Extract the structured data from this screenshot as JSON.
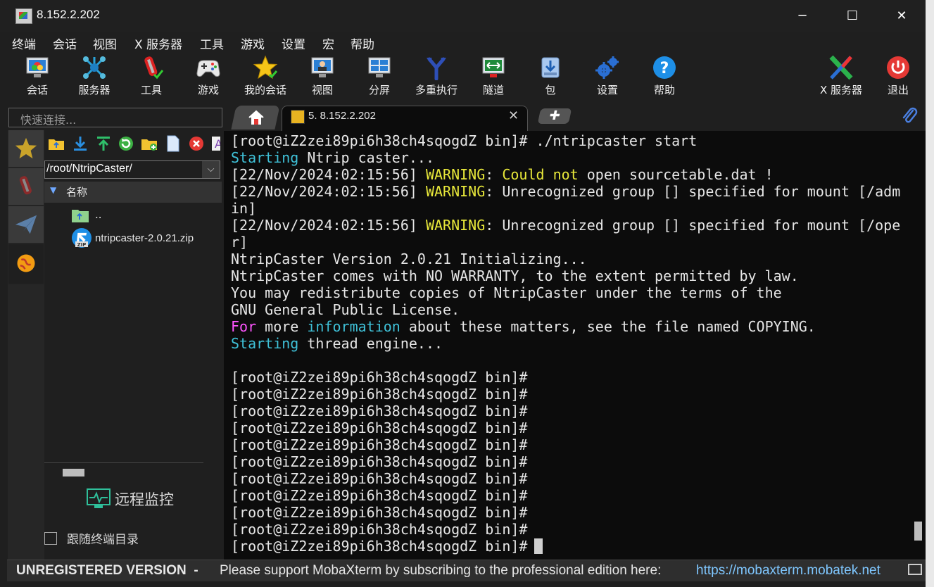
{
  "window": {
    "title": "8.152.2.202"
  },
  "menu": [
    "终端",
    "会话",
    "视图",
    "X 服务器",
    "工具",
    "游戏",
    "设置",
    "宏",
    "帮助"
  ],
  "toolbar": {
    "session": "会话",
    "servers": "服务器",
    "tools": "工具",
    "games": "游戏",
    "my_sessions": "我的会话",
    "view": "视图",
    "split": "分屏",
    "multiexec": "多重执行",
    "tunnel": "隧道",
    "packages": "包",
    "settings": "设置",
    "help": "帮助",
    "xserver": "X 服务器",
    "exit": "退出"
  },
  "quick_connect": {
    "placeholder": "快速连接..."
  },
  "tabs": {
    "active": {
      "title": "5. 8.152.2.202"
    }
  },
  "sftp": {
    "path": "/root/NtripCaster/",
    "column_name": "名称",
    "files": [
      {
        "name": ".."
      },
      {
        "name": "ntripcaster-2.0.21.zip"
      }
    ],
    "remote_monitor": "远程监控",
    "follow_terminal": "跟随终端目录"
  },
  "terminal": {
    "lines": [
      [
        {
          "t": "[root@iZ2zei89pi6h38ch4sqogdZ bin]# ./ntripcaster start",
          "c": "w"
        }
      ],
      [
        {
          "t": "Starting",
          "c": "c"
        },
        {
          "t": " Ntrip caster...",
          "c": "w"
        }
      ],
      [
        {
          "t": "[22/Nov/2024:02:15:56] ",
          "c": "w"
        },
        {
          "t": "WARNING",
          "c": "y"
        },
        {
          "t": ": ",
          "c": "w"
        },
        {
          "t": "Could not",
          "c": "y"
        },
        {
          "t": " open sourcetable.dat !",
          "c": "w"
        }
      ],
      [
        {
          "t": "[22/Nov/2024:02:15:56] ",
          "c": "w"
        },
        {
          "t": "WARNING",
          "c": "y"
        },
        {
          "t": ": Unrecognized group [] specified for mount [/adm",
          "c": "w"
        }
      ],
      [
        {
          "t": "in]",
          "c": "w"
        }
      ],
      [
        {
          "t": "[22/Nov/2024:02:15:56] ",
          "c": "w"
        },
        {
          "t": "WARNING",
          "c": "y"
        },
        {
          "t": ": Unrecognized group [] specified for mount [/ope",
          "c": "w"
        }
      ],
      [
        {
          "t": "r]",
          "c": "w"
        }
      ],
      [
        {
          "t": "NtripCaster Version 2.0.21 Initializing...",
          "c": "w"
        }
      ],
      [
        {
          "t": "NtripCaster comes with NO WARRANTY, to the extent permitted by law.",
          "c": "w"
        }
      ],
      [
        {
          "t": "You may redistribute copies of NtripCaster under the terms of the",
          "c": "w"
        }
      ],
      [
        {
          "t": "GNU General Public License.",
          "c": "w"
        }
      ],
      [
        {
          "t": "For",
          "c": "m"
        },
        {
          "t": " more ",
          "c": "w"
        },
        {
          "t": "information",
          "c": "c"
        },
        {
          "t": " about these matters, see the file named COPYING.",
          "c": "w"
        }
      ],
      [
        {
          "t": "Starting",
          "c": "c"
        },
        {
          "t": " thread engine...",
          "c": "w"
        }
      ],
      [
        {
          "t": "",
          "c": "w"
        }
      ],
      [
        {
          "t": "[root@iZ2zei89pi6h38ch4sqogdZ bin]#",
          "c": "w"
        }
      ],
      [
        {
          "t": "[root@iZ2zei89pi6h38ch4sqogdZ bin]#",
          "c": "w"
        }
      ],
      [
        {
          "t": "[root@iZ2zei89pi6h38ch4sqogdZ bin]#",
          "c": "w"
        }
      ],
      [
        {
          "t": "[root@iZ2zei89pi6h38ch4sqogdZ bin]#",
          "c": "w"
        }
      ],
      [
        {
          "t": "[root@iZ2zei89pi6h38ch4sqogdZ bin]#",
          "c": "w"
        }
      ],
      [
        {
          "t": "[root@iZ2zei89pi6h38ch4sqogdZ bin]#",
          "c": "w"
        }
      ],
      [
        {
          "t": "[root@iZ2zei89pi6h38ch4sqogdZ bin]#",
          "c": "w"
        }
      ],
      [
        {
          "t": "[root@iZ2zei89pi6h38ch4sqogdZ bin]#",
          "c": "w"
        }
      ],
      [
        {
          "t": "[root@iZ2zei89pi6h38ch4sqogdZ bin]#",
          "c": "w"
        }
      ],
      [
        {
          "t": "[root@iZ2zei89pi6h38ch4sqogdZ bin]#",
          "c": "w"
        }
      ],
      [
        {
          "t": "[root@iZ2zei89pi6h38ch4sqogdZ bin]#",
          "c": "w"
        }
      ]
    ],
    "colors": {
      "w": "#e6e6e6",
      "c": "#3fc1d8",
      "y": "#e8e83a",
      "m": "#ff55ff"
    }
  },
  "status": {
    "unregistered": "UNREGISTERED VERSION",
    "separator": "-",
    "message": "Please support MobaXterm by subscribing to the professional edition here:",
    "link": "https://mobaxterm.mobatek.net"
  }
}
